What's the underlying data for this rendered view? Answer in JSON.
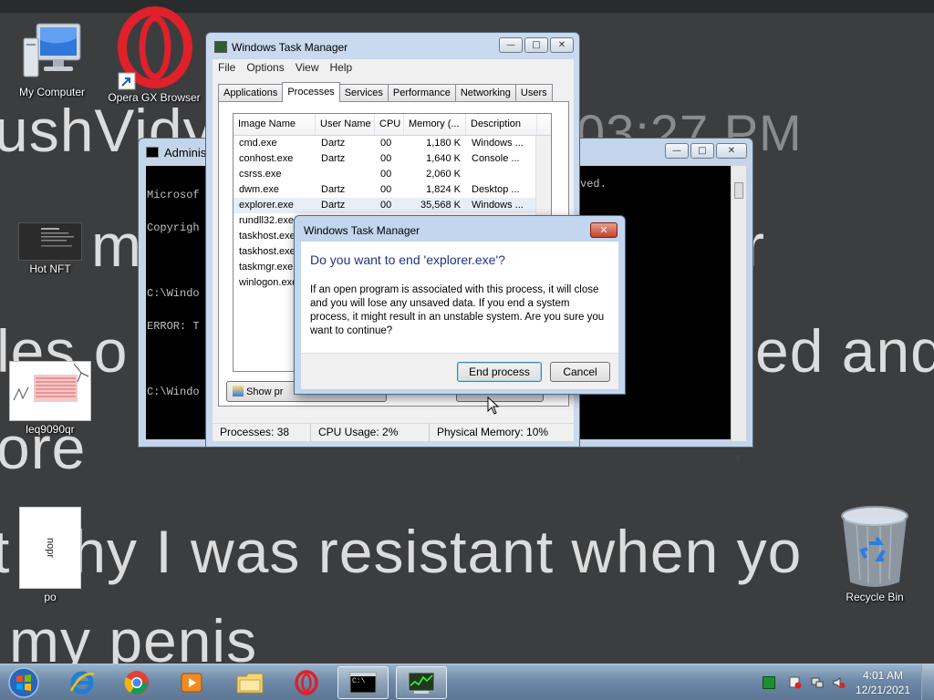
{
  "wallpaper": {
    "lines": [
      "ushVidy",
      "03:27 PM",
      "mak",
      "r",
      "les o",
      "ed and",
      "ore",
      "t why I was resistant when yo",
      "my penis"
    ]
  },
  "desktop_icons": {
    "my_computer": "My Computer",
    "opera_gx": "Opera GX Browser",
    "hot_nft": "Hot NFT",
    "file_leq": "leq9090qr",
    "file_po": "po",
    "file_po_thumb_text": "nopr",
    "recycle_bin": "Recycle Bin"
  },
  "console": {
    "title": "Adminis",
    "lines": [
      "Microsof",
      "Copyrigh",
      "",
      "C:\\Windo",
      "ERROR: T",
      "",
      "C:\\Windo"
    ],
    "right_fragment": "ved.",
    "caption": {
      "minimize": "—",
      "maximize": "□",
      "close": "✕"
    }
  },
  "taskmgr": {
    "title": "Windows Task Manager",
    "menu": [
      "File",
      "Options",
      "View",
      "Help"
    ],
    "tabs": [
      "Applications",
      "Processes",
      "Services",
      "Performance",
      "Networking",
      "Users"
    ],
    "active_tab": "Processes",
    "columns": [
      "Image Name",
      "User Name",
      "CPU",
      "Memory (...",
      "Description"
    ],
    "rows": [
      {
        "image": "cmd.exe",
        "user": "Dartz",
        "cpu": "00",
        "mem": "1,180 K",
        "desc": "Windows ..."
      },
      {
        "image": "conhost.exe",
        "user": "Dartz",
        "cpu": "00",
        "mem": "1,640 K",
        "desc": "Console ..."
      },
      {
        "image": "csrss.exe",
        "user": "",
        "cpu": "00",
        "mem": "2,060 K",
        "desc": ""
      },
      {
        "image": "dwm.exe",
        "user": "Dartz",
        "cpu": "00",
        "mem": "1,824 K",
        "desc": "Desktop ..."
      },
      {
        "image": "explorer.exe",
        "user": "Dartz",
        "cpu": "00",
        "mem": "35,568 K",
        "desc": "Windows ..."
      },
      {
        "image": "rundll32.exe",
        "user": "",
        "cpu": "",
        "mem": "",
        "desc": ""
      },
      {
        "image": "taskhost.exe",
        "user": "",
        "cpu": "",
        "mem": "",
        "desc": ""
      },
      {
        "image": "taskhost.exe",
        "user": "",
        "cpu": "",
        "mem": "",
        "desc": ""
      },
      {
        "image": "taskmgr.exe",
        "user": "",
        "cpu": "",
        "mem": "",
        "desc": ""
      },
      {
        "image": "winlogon.exe",
        "user": "",
        "cpu": "",
        "mem": "",
        "desc": ""
      }
    ],
    "show_processes_button": "Show pr",
    "status": {
      "processes": "Processes: 38",
      "cpu": "CPU Usage: 2%",
      "memory": "Physical Memory: 10%"
    }
  },
  "dialog": {
    "title": "Windows Task Manager",
    "heading": "Do you want to end 'explorer.exe'?",
    "message": "If an open program is associated with this process, it will close and you will lose any unsaved data. If you end a system process, it might result in an unstable system. Are you sure you want to continue?",
    "end_button": "End process",
    "cancel_button": "Cancel",
    "close_glyph": "✕"
  },
  "taskbar": {
    "console_label": "C:\\",
    "clock_time": "4:01 AM",
    "clock_date": "12/21/2021"
  },
  "colors": {
    "dialog_heading": "#1e3287",
    "wallpaper_bg": "#3c3d3f",
    "wallpaper_text": "#dcdcdc",
    "opera_red": "#e0202a"
  }
}
